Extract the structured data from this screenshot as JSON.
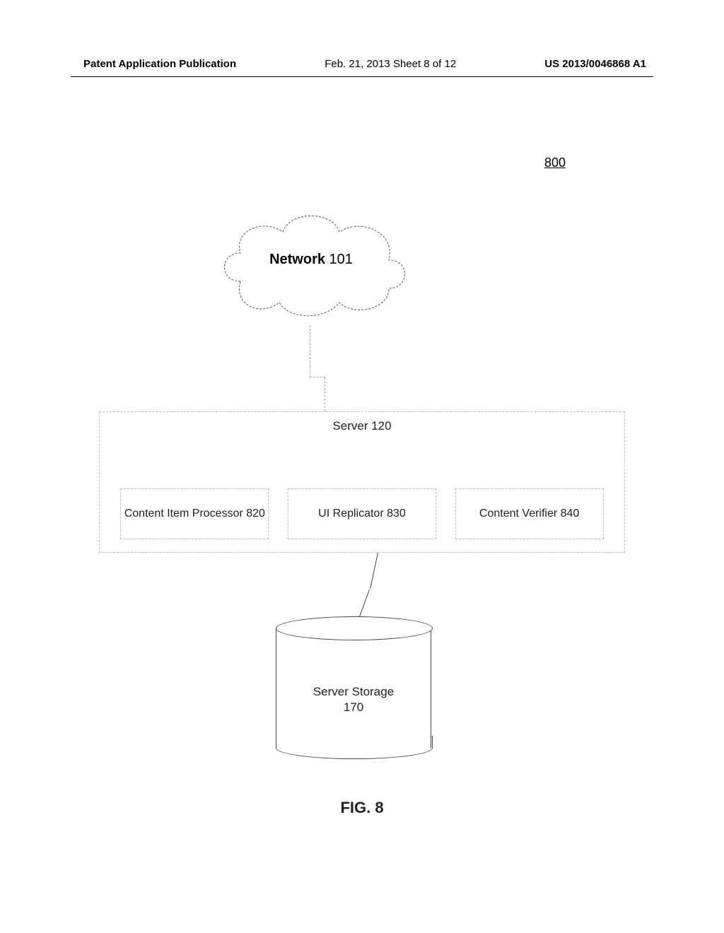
{
  "header": {
    "left": "Patent Application Publication",
    "mid": "Feb. 21, 2013  Sheet 8 of 12",
    "right": "US 2013/0046868 A1"
  },
  "figure_ref": "800",
  "cloud": {
    "bold": "Network",
    "num": " 101"
  },
  "server": {
    "title": "Server 120",
    "modules": [
      "Content Item Processor 820",
      "UI Replicator 830",
      "Content Verifier 840"
    ]
  },
  "storage": {
    "line1": "Server Storage",
    "line2": "170"
  },
  "caption": "FIG. 8"
}
